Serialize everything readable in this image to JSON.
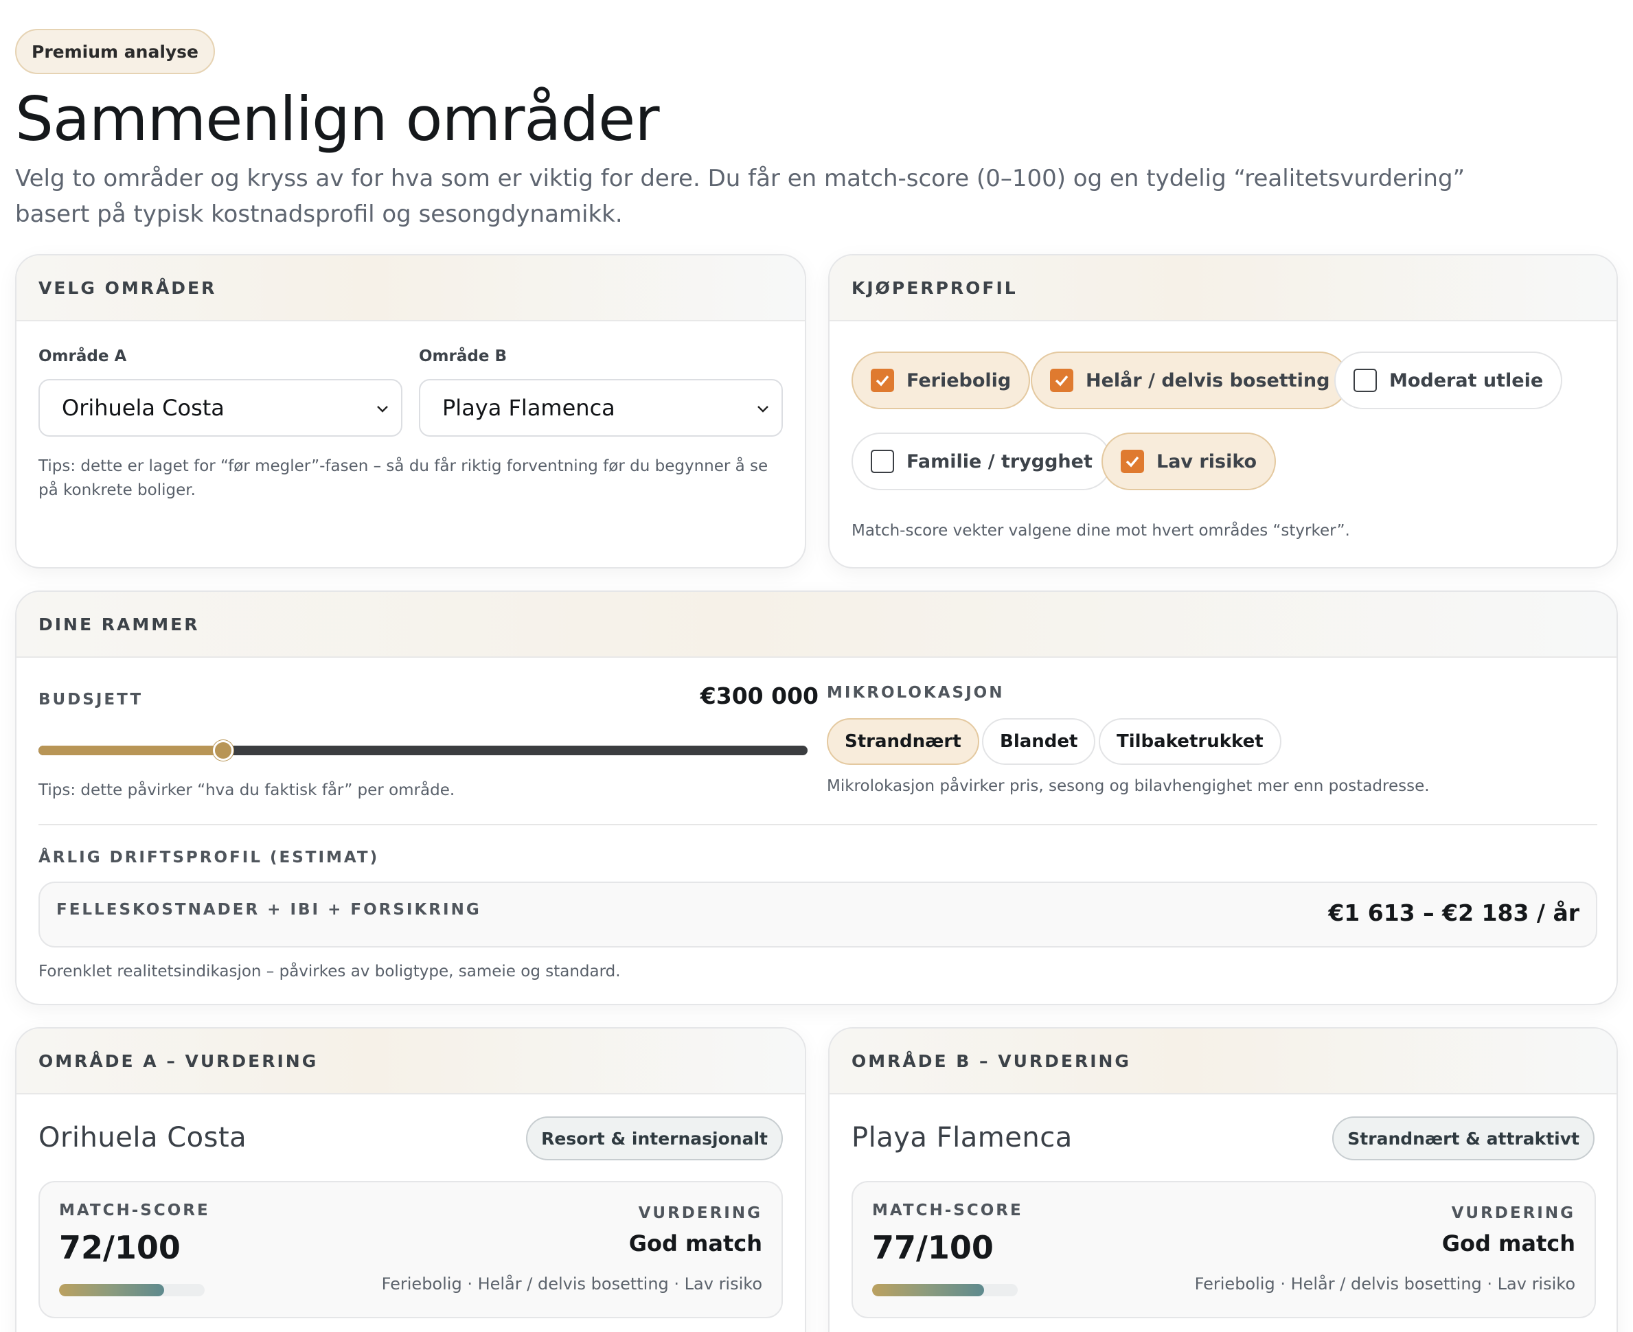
{
  "badge": "Premium analyse",
  "title": "Sammenlign områder",
  "lead": "Velg to områder og kryss av for hva som er viktig for dere. Du får en match-score (0–100) og en tydelig “realitetsvurdering” basert på typisk kostnadsprofil og sesongdynamikk.",
  "areas_card": {
    "heading": "VELG OMRÅDER",
    "area_a_label": "Område A",
    "area_a_value": "Orihuela Costa",
    "area_b_label": "Område B",
    "area_b_value": "Playa Flamenca",
    "tip": "Tips: dette er laget for “før megler”-fasen – så du får riktig forventning før du begynner å se på konkrete boliger."
  },
  "profile_card": {
    "heading": "KJØPERPROFIL",
    "options": [
      {
        "label": "Feriebolig",
        "checked": true
      },
      {
        "label": "Helår / delvis bosetting",
        "checked": true
      },
      {
        "label": "Moderat utleie",
        "checked": false
      },
      {
        "label": "Familie / trygghet",
        "checked": false
      },
      {
        "label": "Lav risiko",
        "checked": true
      }
    ],
    "note": "Match-score vekter valgene dine mot hvert områdes “styrker”."
  },
  "frame_card": {
    "heading": "DINE RAMMER",
    "budget_label": "BUDSJETT",
    "budget_value": "€300 000",
    "budget_fraction": 0.24,
    "budget_tip": "Tips: dette påvirker “hva du faktisk får” per område.",
    "micro_label": "MIKROLOKASJON",
    "micro_options": [
      {
        "label": "Strandnært",
        "selected": true
      },
      {
        "label": "Blandet",
        "selected": false
      },
      {
        "label": "Tilbaketrukket",
        "selected": false
      }
    ],
    "micro_note": "Mikrolokasjon påvirker pris, sesong og bilavhengighet mer enn postadresse.",
    "annual_label": "ÅRLIG DRIFTSPROFIL (ESTIMAT)",
    "cost_label": "FELLESKOSTNADER + IBI + FORSIKRING",
    "cost_value": "€1 613 – €2 183 / år",
    "cost_note": "Forenklet realitetsindikasjon – påvirkes av boligtype, sameie og standard."
  },
  "assessments": [
    {
      "heading": "OMRÅDE A – VURDERING",
      "name": "Orihuela Costa",
      "tag": "Resort & internasjonalt",
      "score_label": "MATCH-SCORE",
      "score": "72/100",
      "score_fraction": 0.72,
      "verdict_label": "VURDERING",
      "verdict": "God match",
      "prefs": "Feriebolig · Helår / delvis bosetting · Lav risiko"
    },
    {
      "heading": "OMRÅDE B – VURDERING",
      "name": "Playa Flamenca",
      "tag": "Strandnært & attraktivt",
      "score_label": "MATCH-SCORE",
      "score": "77/100",
      "score_fraction": 0.77,
      "verdict_label": "VURDERING",
      "verdict": "God match",
      "prefs": "Feriebolig · Helår / delvis bosetting · Lav risiko"
    }
  ],
  "colors": {
    "accent_orange": "#df7a2f",
    "accent_gold": "#b89556",
    "selected_bg": "#f8ecdb"
  }
}
